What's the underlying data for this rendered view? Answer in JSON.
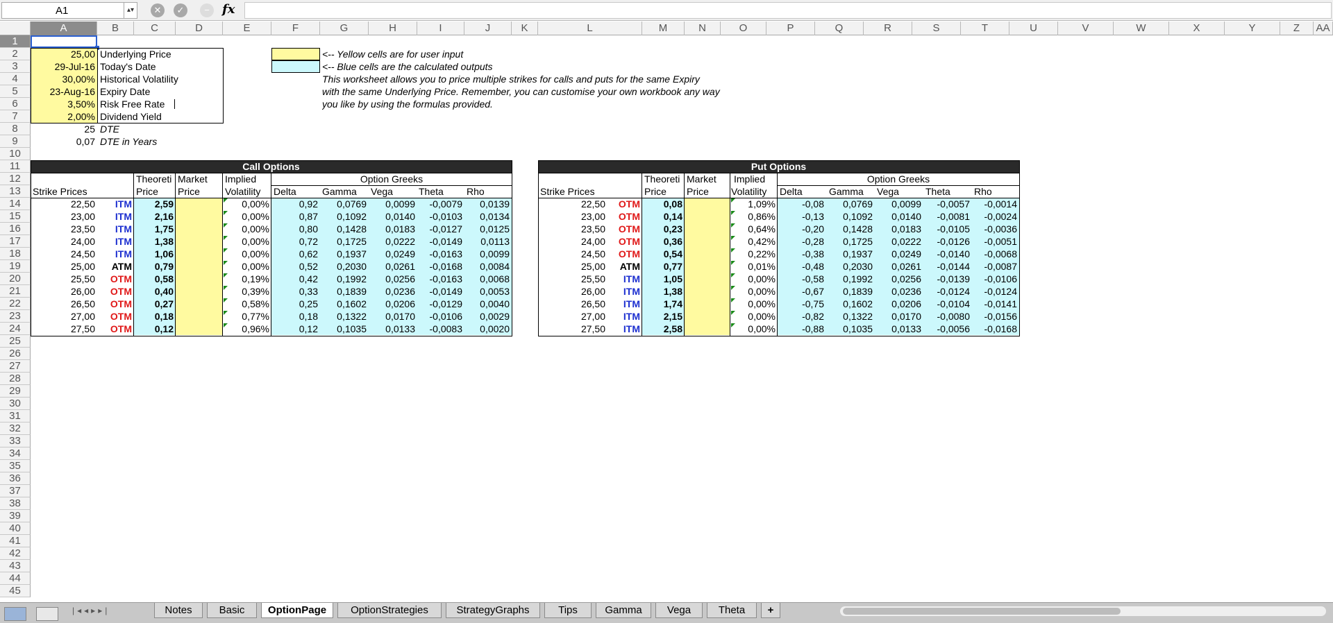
{
  "formula_bar": {
    "name_box": "A1",
    "fx": "fx"
  },
  "columns": [
    "A",
    "B",
    "C",
    "D",
    "E",
    "F",
    "G",
    "H",
    "I",
    "J",
    "K",
    "L",
    "M",
    "N",
    "O",
    "P",
    "Q",
    "R",
    "S",
    "T",
    "U",
    "V",
    "W",
    "X",
    "Y",
    "Z",
    "AA"
  ],
  "rows": [
    "1",
    "2",
    "3",
    "4",
    "5",
    "6",
    "7",
    "8",
    "9",
    "10",
    "11",
    "12",
    "13",
    "14",
    "15",
    "16",
    "17",
    "18",
    "19",
    "20",
    "21",
    "22",
    "23",
    "24",
    "25",
    "26",
    "27",
    "28",
    "29",
    "30",
    "31",
    "32",
    "33",
    "34",
    "35",
    "36",
    "37",
    "38",
    "39",
    "40",
    "41",
    "42",
    "43",
    "44",
    "45"
  ],
  "inputs": [
    {
      "value": "25,00",
      "label": "Underlying Price"
    },
    {
      "value": "29-Jul-16",
      "label": "Today's Date"
    },
    {
      "value": "30,00%",
      "label": "Historical Volatility"
    },
    {
      "value": "23-Aug-16",
      "label": "Expiry Date"
    },
    {
      "value": "3,50%",
      "label": "Risk Free Rate"
    },
    {
      "value": "2,00%",
      "label": "Dividend Yield"
    }
  ],
  "dte": {
    "value": "25",
    "label": "DTE"
  },
  "dte_years": {
    "value": "0,07",
    "label": "DTE in Years"
  },
  "legend": {
    "yellow": "<-- Yellow cells are for user input",
    "blue": "<-- Blue cells are the calculated outputs"
  },
  "notes": [
    "This worksheet allows you to price multiple strikes for calls and puts for the same Expiry",
    "with the same Underlying Price. Remember, you can customise your own workbook any way",
    "you like by using the formulas provided."
  ],
  "headers": {
    "call_title": "Call Options",
    "put_title": "Put Options",
    "strike": "Strike Prices",
    "theo1": "Theoreti",
    "theo2": "Price",
    "mkt1": "Market",
    "mkt2": "Price",
    "impl1": "Implied",
    "impl2": "Volatility",
    "greeks": "Option Greeks",
    "delta": "Delta",
    "gamma": "Gamma",
    "vega": "Vega",
    "theta": "Theta",
    "rho": "Rho"
  },
  "calls": [
    {
      "strike": "22,50",
      "status": "ITM",
      "theo": "2,59",
      "iv": "0,00%",
      "delta": "0,92",
      "gamma": "0,0769",
      "vega": "0,0099",
      "theta": "-0,0079",
      "rho": "0,0139"
    },
    {
      "strike": "23,00",
      "status": "ITM",
      "theo": "2,16",
      "iv": "0,00%",
      "delta": "0,87",
      "gamma": "0,1092",
      "vega": "0,0140",
      "theta": "-0,0103",
      "rho": "0,0134"
    },
    {
      "strike": "23,50",
      "status": "ITM",
      "theo": "1,75",
      "iv": "0,00%",
      "delta": "0,80",
      "gamma": "0,1428",
      "vega": "0,0183",
      "theta": "-0,0127",
      "rho": "0,0125"
    },
    {
      "strike": "24,00",
      "status": "ITM",
      "theo": "1,38",
      "iv": "0,00%",
      "delta": "0,72",
      "gamma": "0,1725",
      "vega": "0,0222",
      "theta": "-0,0149",
      "rho": "0,0113"
    },
    {
      "strike": "24,50",
      "status": "ITM",
      "theo": "1,06",
      "iv": "0,00%",
      "delta": "0,62",
      "gamma": "0,1937",
      "vega": "0,0249",
      "theta": "-0,0163",
      "rho": "0,0099"
    },
    {
      "strike": "25,00",
      "status": "ATM",
      "theo": "0,79",
      "iv": "0,00%",
      "delta": "0,52",
      "gamma": "0,2030",
      "vega": "0,0261",
      "theta": "-0,0168",
      "rho": "0,0084"
    },
    {
      "strike": "25,50",
      "status": "OTM",
      "theo": "0,58",
      "iv": "0,19%",
      "delta": "0,42",
      "gamma": "0,1992",
      "vega": "0,0256",
      "theta": "-0,0163",
      "rho": "0,0068"
    },
    {
      "strike": "26,00",
      "status": "OTM",
      "theo": "0,40",
      "iv": "0,39%",
      "delta": "0,33",
      "gamma": "0,1839",
      "vega": "0,0236",
      "theta": "-0,0149",
      "rho": "0,0053"
    },
    {
      "strike": "26,50",
      "status": "OTM",
      "theo": "0,27",
      "iv": "0,58%",
      "delta": "0,25",
      "gamma": "0,1602",
      "vega": "0,0206",
      "theta": "-0,0129",
      "rho": "0,0040"
    },
    {
      "strike": "27,00",
      "status": "OTM",
      "theo": "0,18",
      "iv": "0,77%",
      "delta": "0,18",
      "gamma": "0,1322",
      "vega": "0,0170",
      "theta": "-0,0106",
      "rho": "0,0029"
    },
    {
      "strike": "27,50",
      "status": "OTM",
      "theo": "0,12",
      "iv": "0,96%",
      "delta": "0,12",
      "gamma": "0,1035",
      "vega": "0,0133",
      "theta": "-0,0083",
      "rho": "0,0020"
    }
  ],
  "puts": [
    {
      "strike": "22,50",
      "status": "OTM",
      "theo": "0,08",
      "iv": "1,09%",
      "delta": "-0,08",
      "gamma": "0,0769",
      "vega": "0,0099",
      "theta": "-0,0057",
      "rho": "-0,0014"
    },
    {
      "strike": "23,00",
      "status": "OTM",
      "theo": "0,14",
      "iv": "0,86%",
      "delta": "-0,13",
      "gamma": "0,1092",
      "vega": "0,0140",
      "theta": "-0,0081",
      "rho": "-0,0024"
    },
    {
      "strike": "23,50",
      "status": "OTM",
      "theo": "0,23",
      "iv": "0,64%",
      "delta": "-0,20",
      "gamma": "0,1428",
      "vega": "0,0183",
      "theta": "-0,0105",
      "rho": "-0,0036"
    },
    {
      "strike": "24,00",
      "status": "OTM",
      "theo": "0,36",
      "iv": "0,42%",
      "delta": "-0,28",
      "gamma": "0,1725",
      "vega": "0,0222",
      "theta": "-0,0126",
      "rho": "-0,0051"
    },
    {
      "strike": "24,50",
      "status": "OTM",
      "theo": "0,54",
      "iv": "0,22%",
      "delta": "-0,38",
      "gamma": "0,1937",
      "vega": "0,0249",
      "theta": "-0,0140",
      "rho": "-0,0068"
    },
    {
      "strike": "25,00",
      "status": "ATM",
      "theo": "0,77",
      "iv": "0,01%",
      "delta": "-0,48",
      "gamma": "0,2030",
      "vega": "0,0261",
      "theta": "-0,0144",
      "rho": "-0,0087"
    },
    {
      "strike": "25,50",
      "status": "ITM",
      "theo": "1,05",
      "iv": "0,00%",
      "delta": "-0,58",
      "gamma": "0,1992",
      "vega": "0,0256",
      "theta": "-0,0139",
      "rho": "-0,0106"
    },
    {
      "strike": "26,00",
      "status": "ITM",
      "theo": "1,38",
      "iv": "0,00%",
      "delta": "-0,67",
      "gamma": "0,1839",
      "vega": "0,0236",
      "theta": "-0,0124",
      "rho": "-0,0124"
    },
    {
      "strike": "26,50",
      "status": "ITM",
      "theo": "1,74",
      "iv": "0,00%",
      "delta": "-0,75",
      "gamma": "0,1602",
      "vega": "0,0206",
      "theta": "-0,0104",
      "rho": "-0,0141"
    },
    {
      "strike": "27,00",
      "status": "ITM",
      "theo": "2,15",
      "iv": "0,00%",
      "delta": "-0,82",
      "gamma": "0,1322",
      "vega": "0,0170",
      "theta": "-0,0080",
      "rho": "-0,0156"
    },
    {
      "strike": "27,50",
      "status": "ITM",
      "theo": "2,58",
      "iv": "0,00%",
      "delta": "-0,88",
      "gamma": "0,1035",
      "vega": "0,0133",
      "theta": "-0,0056",
      "rho": "-0,0168"
    }
  ],
  "tabs": [
    "Notes",
    "Basic",
    "OptionPage",
    "OptionStrategies",
    "StrategyGraphs",
    "Tips",
    "Gamma",
    "Vega",
    "Theta"
  ],
  "active_tab": "OptionPage",
  "colors": {
    "input_yellow": "#fffaa0",
    "output_blue": "#ccf8fc",
    "itm": "#1c2fd0",
    "otm": "#e01818",
    "header_dark": "#2a2a2a"
  }
}
